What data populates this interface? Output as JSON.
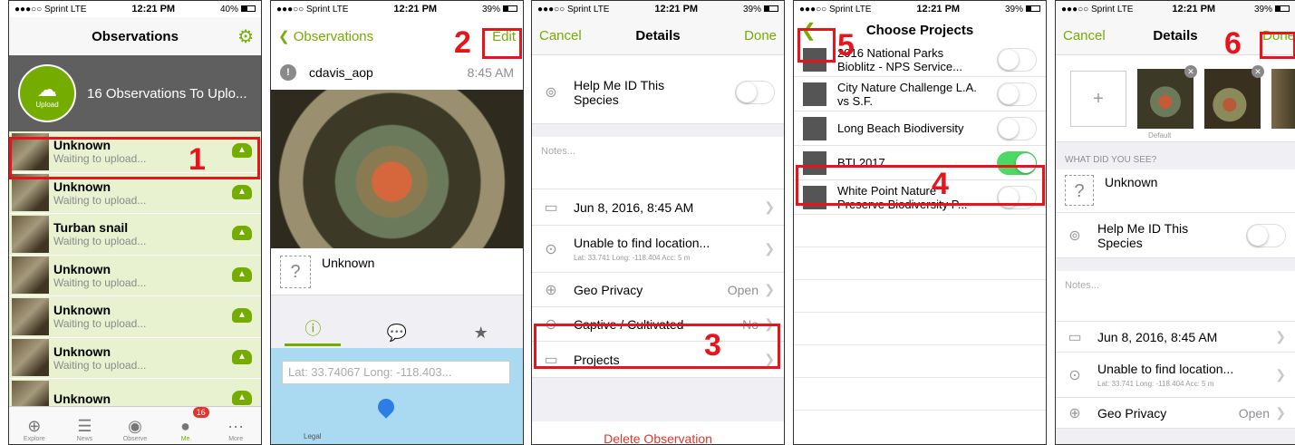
{
  "colors": {
    "accent": "#74ac00",
    "highlight": "#e8141b",
    "toggle_on": "#4cd964"
  },
  "screen1": {
    "status": {
      "carrier": "●●●○○ Sprint  LTE",
      "time": "12:21 PM",
      "battery": "40%",
      "battery_level": 0.4
    },
    "title": "Observations",
    "settings_icon": "gear-icon",
    "upload_label": "Upload",
    "upload_text": "16 Observations To Uplo...",
    "observations": [
      {
        "name": "Unknown",
        "status": "Waiting to upload..."
      },
      {
        "name": "Unknown",
        "status": "Waiting to upload..."
      },
      {
        "name": "Turban snail",
        "status": "Waiting to upload..."
      },
      {
        "name": "Unknown",
        "status": "Waiting to upload..."
      },
      {
        "name": "Unknown",
        "status": "Waiting to upload..."
      },
      {
        "name": "Unknown",
        "status": "Waiting to upload..."
      },
      {
        "name": "Unknown",
        "status": ""
      }
    ],
    "tabs": {
      "explore": "Explore",
      "news": "News",
      "observe": "Observe",
      "me": "Me",
      "more": "More",
      "me_badge": "16"
    },
    "step": "1"
  },
  "screen2": {
    "status": {
      "carrier": "●●●○○ Sprint  LTE",
      "time": "12:21 PM",
      "battery": "39%",
      "battery_level": 0.39
    },
    "back_label": "Observations",
    "edit_label": "Edit",
    "username": "cdavis_aop",
    "time": "8:45 AM",
    "taxon": "Unknown",
    "map_search": "Lat: 33.74067 Long: -118.403...",
    "legal": "Legal",
    "step": "2"
  },
  "screen3": {
    "status": {
      "carrier": "●●●○○ Sprint  LTE",
      "time": "12:21 PM",
      "battery": "39%",
      "battery_level": 0.39
    },
    "cancel": "Cancel",
    "title": "Details",
    "done": "Done",
    "help_label": "Help Me ID This Species",
    "notes_placeholder": "Notes...",
    "date": "Jun 8, 2016, 8:45 AM",
    "location": "Unable to find location...",
    "location_sub": "Lat: 33.741  Long: -118.404  Acc: 5 m",
    "geo_privacy": "Geo Privacy",
    "geo_value": "Open",
    "captive": "Captive / Cultivated",
    "captive_value": "No",
    "projects": "Projects",
    "delete": "Delete Observation",
    "step": "3"
  },
  "screen4": {
    "status": {
      "carrier": "●●●○○ Sprint  LTE",
      "time": "12:21 PM",
      "battery": "39%",
      "battery_level": 0.39
    },
    "title": "Choose Projects",
    "projects": [
      {
        "name": "2016 National Parks Bioblitz - NPS Service...",
        "on": false
      },
      {
        "name": "City Nature Challenge L.A. vs S.F.",
        "on": false
      },
      {
        "name": "Long Beach Biodiversity",
        "on": false
      },
      {
        "name": "BTI 2017",
        "on": true
      },
      {
        "name": "White Point Nature Preserve Biodiversity P...",
        "on": false
      }
    ],
    "step4": "4",
    "step5": "5"
  },
  "screen5": {
    "status": {
      "carrier": "●●●○○ Sprint  LTE",
      "time": "12:21 PM",
      "battery": "39%",
      "battery_level": 0.39
    },
    "cancel": "Cancel",
    "title": "Details",
    "done": "Done",
    "add_photo": "+",
    "default_label": "Default",
    "section": "WHAT DID YOU SEE?",
    "taxon": "Unknown",
    "help_label": "Help Me ID This Species",
    "notes_placeholder": "Notes...",
    "date": "Jun 8, 2016, 8:45 AM",
    "location": "Unable to find location...",
    "location_sub": "Lat: 33.741  Long: -118.404  Acc: 5 m",
    "geo_privacy": "Geo Privacy",
    "geo_value": "Open",
    "step": "6"
  }
}
